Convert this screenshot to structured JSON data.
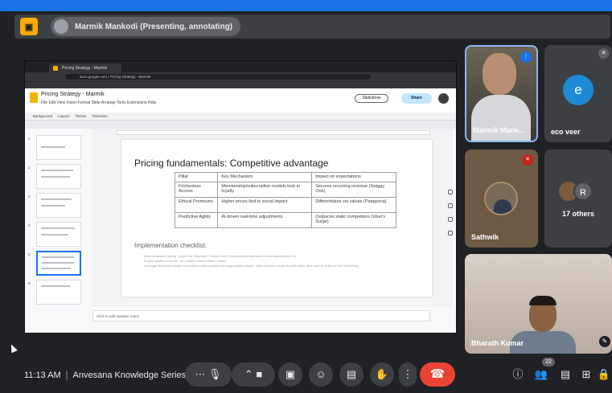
{
  "presenter": {
    "name": "Marmik Mankodi (Presenting, annotating)"
  },
  "browser": {
    "tab_label": "Pricing Strategy - Marmik",
    "url": "docs.google.com / Pricing Strategy - Marmik"
  },
  "docs": {
    "title": "Pricing Strategy - Marmik",
    "menu": "File  Edit  View  Insert  Format  Slide  Arrange  Tools  Extensions  Help",
    "slideshow_label": "Slideshow",
    "share_label": "Share",
    "toolbar": [
      "Background",
      "Layout",
      "Theme",
      "Transition"
    ],
    "speaker_notes_placeholder": "Click to add speaker notes"
  },
  "slide": {
    "title": "Pricing fundamentals: Competitive advantage",
    "table": {
      "headers": [
        "Pillar",
        "Key Mechanism",
        "Impact on expectations"
      ],
      "rows": [
        [
          "Frictionless Access",
          "Membership/subscription models lock in loyalty",
          "Secures recurring revenue (Swiggy One)"
        ],
        [
          "Ethical Premiums",
          "Higher prices tied to social impact",
          "Differentiates via values (Patagonia)"
        ],
        [
          "Predictive Agility",
          "AI-driven real-time adjustments",
          "Outpaces static competitors (Uber's Surge)"
        ]
      ]
    },
    "checklist_title": "Implementation checklist:",
    "checklist": [
      "Build ecosystem pricing - Apple One, Microsoft + Adobe's shift from perpetual licenses to cloud subscriptions, etc",
      "Deploy stealth premiums - for Jordan's limited edition collabs",
      "Leverage behavioral nudges to transform static products into upgradeable assets - Netic common on gaming with skins, also used by Tesla for Full Self Driving"
    ]
  },
  "thumb_numbers": [
    "1",
    "2",
    "3",
    "4",
    "5",
    "6"
  ],
  "participants": {
    "marmik": "Marmik Mank...",
    "eco": {
      "name": "eco veer",
      "initial": "e"
    },
    "sathwik": "Sathwik",
    "others": {
      "label": "17 others",
      "initial": "R"
    },
    "bharath": "Bharath Kumar"
  },
  "meeting": {
    "time": "11:13 AM",
    "name": "Anvesana Knowledge Series:..."
  },
  "controls": {
    "participant_count": "22"
  }
}
